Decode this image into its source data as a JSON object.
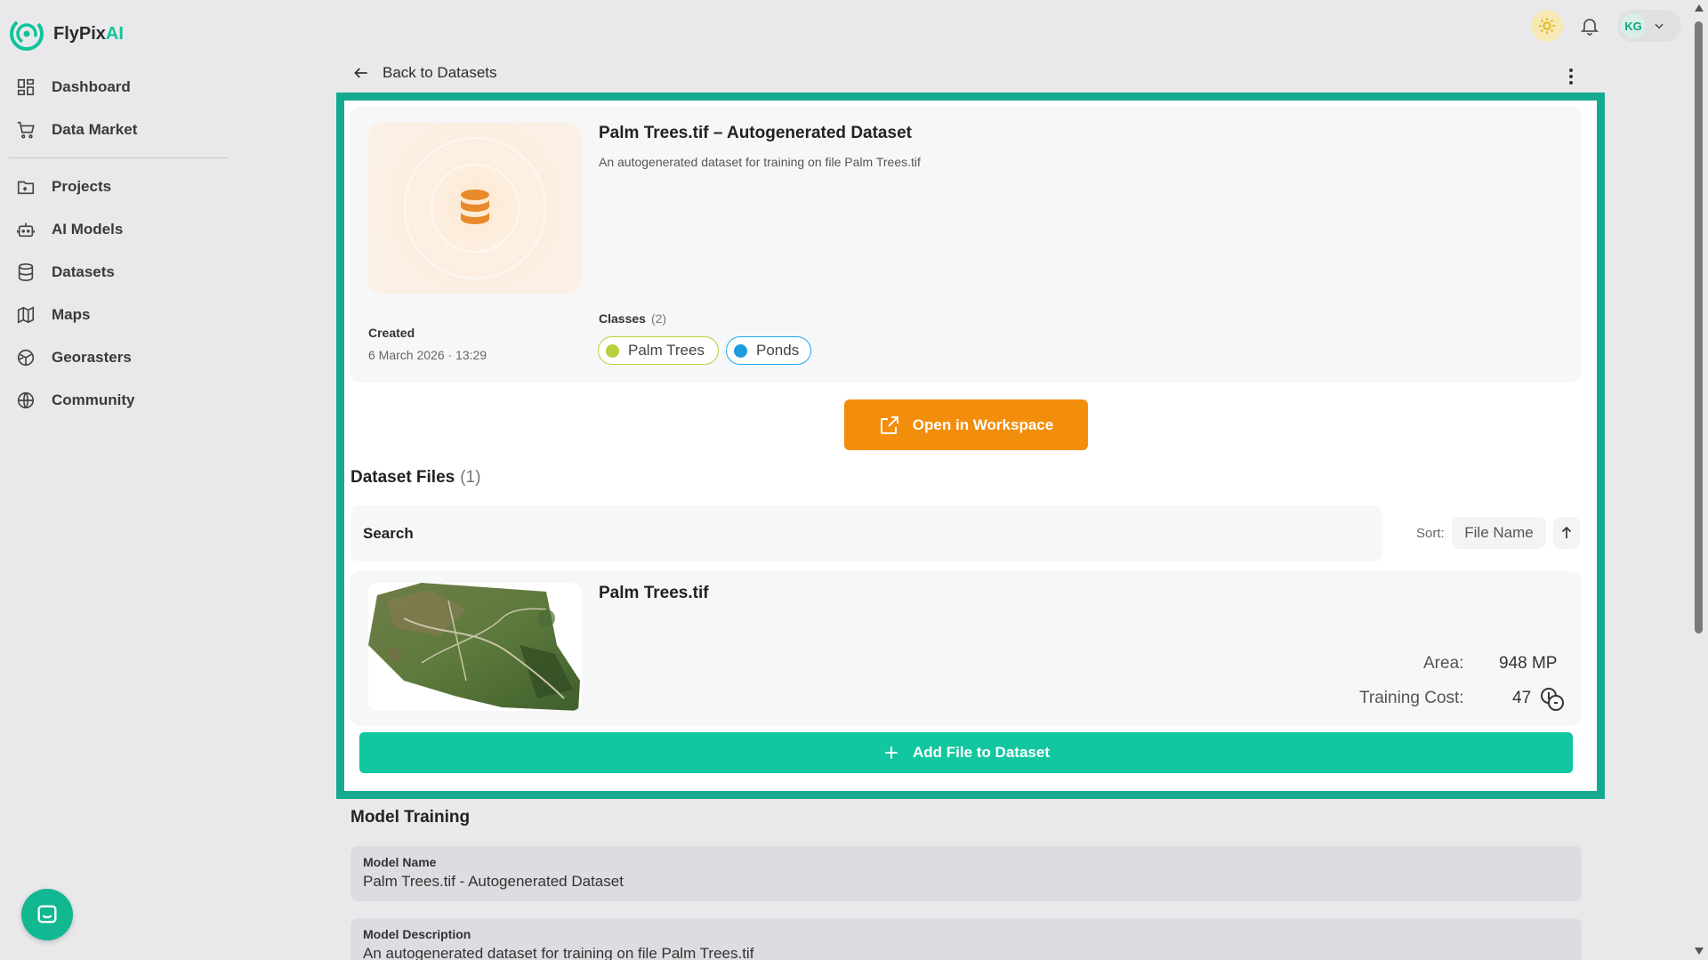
{
  "brand": {
    "name_main": "FlyPix",
    "name_accent": "AI",
    "accent_color": "#10c49b"
  },
  "sidebar": {
    "items": [
      {
        "label": "Dashboard",
        "icon": "dashboard-icon"
      },
      {
        "label": "Data Market",
        "icon": "cart-icon"
      },
      {
        "label": "Projects",
        "icon": "folder-icon"
      },
      {
        "label": "AI Models",
        "icon": "robot-icon"
      },
      {
        "label": "Datasets",
        "icon": "database-icon"
      },
      {
        "label": "Maps",
        "icon": "map-icon"
      },
      {
        "label": "Georasters",
        "icon": "globe-grid-icon"
      },
      {
        "label": "Community",
        "icon": "globe-icon"
      }
    ]
  },
  "header": {
    "user_initials": "KG"
  },
  "nav": {
    "back_label": "Back to Datasets"
  },
  "dataset": {
    "title": "Palm Trees.tif – Autogenerated Dataset",
    "description": "An autogenerated dataset for training on file Palm Trees.tif",
    "created_label": "Created",
    "created_value": "6 March 2026 · 13:29",
    "classes_label": "Classes",
    "classes_count": "(2)",
    "classes": [
      {
        "name": "Palm Trees",
        "color": "#b8d13a"
      },
      {
        "name": "Ponds",
        "color": "#1e9be0"
      }
    ],
    "open_button": "Open in Workspace"
  },
  "files": {
    "heading": "Dataset Files",
    "count": "(1)",
    "search_placeholder": "Search",
    "sort_label": "Sort:",
    "sort_value": "File Name",
    "items": [
      {
        "name": "Palm Trees.tif",
        "area_label": "Area:",
        "area_value": "948 MP",
        "cost_label": "Training Cost:",
        "cost_value": "47"
      }
    ],
    "add_button": "Add File to Dataset"
  },
  "training": {
    "heading": "Model Training",
    "model_name_label": "Model Name",
    "model_name_value": "Palm Trees.tif - Autogenerated Dataset",
    "model_desc_label": "Model Description",
    "model_desc_value": "An autogenerated dataset for training on file Palm Trees.tif"
  },
  "colors": {
    "highlight_frame": "#15aa8f",
    "primary_orange": "#f38d0c",
    "primary_green": "#12c79f"
  }
}
